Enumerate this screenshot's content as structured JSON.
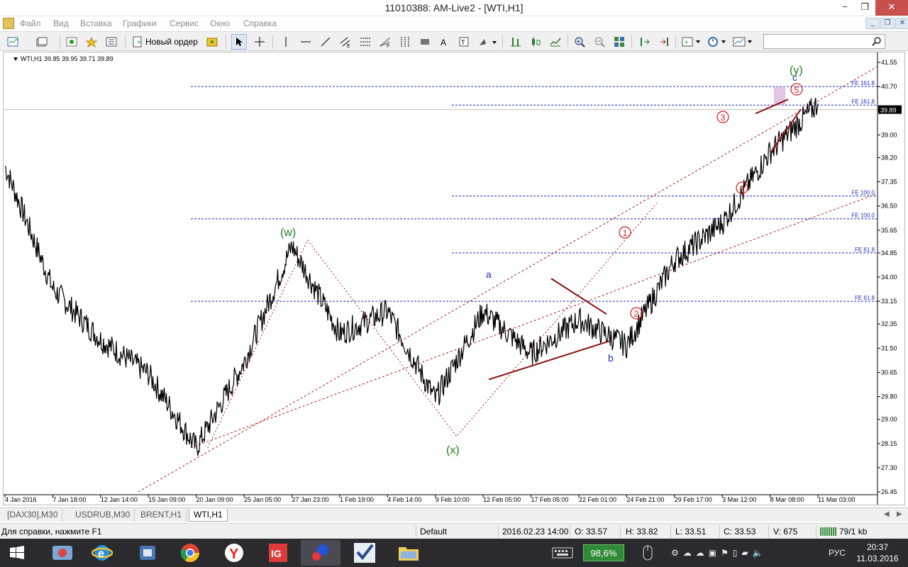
{
  "window": {
    "title": "11010388: AM-Live2 - [WTI,H1]",
    "minimize": "−",
    "restore": "❐",
    "close": "✕",
    "mdi_minimize": "_",
    "mdi_restore": "❐",
    "mdi_close": "✕"
  },
  "menu": [
    "Файл",
    "Вид",
    "Вставка",
    "Графики",
    "Сервис",
    "Окно",
    "Справка"
  ],
  "toolbar": {
    "new_order_label": "Новый ордер",
    "search_placeholder": ""
  },
  "chart": {
    "symbol_info": "WTI,H1  39.85 39.95 39.71 39.89",
    "current_price": "39.89",
    "price_ticks": [
      "41.55",
      "40.70",
      "39.89",
      "39.00",
      "38.20",
      "37.35",
      "36.50",
      "35.65",
      "34.85",
      "34.00",
      "33.15",
      "32.35",
      "31.50",
      "30.65",
      "29.80",
      "29.00",
      "28.15",
      "27.30",
      "26.45"
    ],
    "time_ticks": [
      "4 Jan 2016",
      "7 Jan 18:00",
      "12 Jan 14:00",
      "15 Jan 09:00",
      "20 Jan 09:00",
      "25 Jan 05:00",
      "27 Jan 23:00",
      "1 Feb 19:00",
      "4 Feb 14:00",
      "9 Feb 10:00",
      "12 Feb 05:00",
      "17 Feb 05:00",
      "22 Feb 01:00",
      "24 Feb 21:00",
      "29 Feb 17:00",
      "3 Mar 12:00",
      "8 Mar 08:00",
      "11 Mar 03:00"
    ],
    "fib_labels": [
      "FE 161.8",
      "FE 161.8",
      "FE 100.0",
      "FE 100.0",
      "FE 61.8",
      "FE 61.8"
    ],
    "wave_labels": {
      "w": "(w)",
      "x": "(x)",
      "y": "(y)",
      "a": "a",
      "b": "b",
      "c": "c",
      "w1": "1",
      "w2": "2",
      "w3": "3",
      "w4": "4",
      "w5": "5"
    },
    "colors": {
      "wave_major": "#1e7f1e",
      "wave_abc": "#1f2fbf",
      "wave_impulse": "#d01b1b",
      "trend_line": "#8b1010",
      "fib_line": "#1f2fbf",
      "channel_line": "#b01b1b",
      "target_zone": "#d9b6dc"
    },
    "chart_data": {
      "type": "line",
      "title": "",
      "xlabel": "",
      "ylabel": "",
      "ylim": [
        26.45,
        41.55
      ],
      "x": [
        "4 Jan 2016",
        "7 Jan 18:00",
        "12 Jan 14:00",
        "15 Jan 09:00",
        "20 Jan 09:00",
        "25 Jan 05:00",
        "27 Jan 23:00",
        "1 Feb 19:00",
        "4 Feb 14:00",
        "9 Feb 10:00",
        "12 Feb 05:00",
        "17 Feb 05:00",
        "22 Feb 01:00",
        "24 Feb 21:00",
        "29 Feb 17:00",
        "3 Mar 12:00",
        "8 Mar 08:00",
        "11 Mar 03:00"
      ],
      "series": [
        {
          "values": [
            37.9,
            33.6,
            31.8,
            30.6,
            28.0,
            31.0,
            35.1,
            32.0,
            32.8,
            29.7,
            32.8,
            31.3,
            32.5,
            31.6,
            34.6,
            35.9,
            38.4,
            40.1
          ]
        }
      ]
    }
  },
  "tabs": [
    "[DAX30],M30",
    "USDRUB,M30",
    "BRENT,H1",
    "WTI,H1"
  ],
  "status": {
    "help": "Для справки, нажмите F1",
    "profile": "Default",
    "datetime": "2016.02.23 14:00",
    "open": "O: 33.57",
    "high": "H: 33.82",
    "low": "L: 33.51",
    "close": "C: 33.53",
    "volume": "V: 675",
    "traffic": "79/1 kb"
  },
  "taskbar": {
    "battery": "98,6%",
    "lang": "РУС",
    "time": "20:37",
    "date": "11.03.2016"
  }
}
